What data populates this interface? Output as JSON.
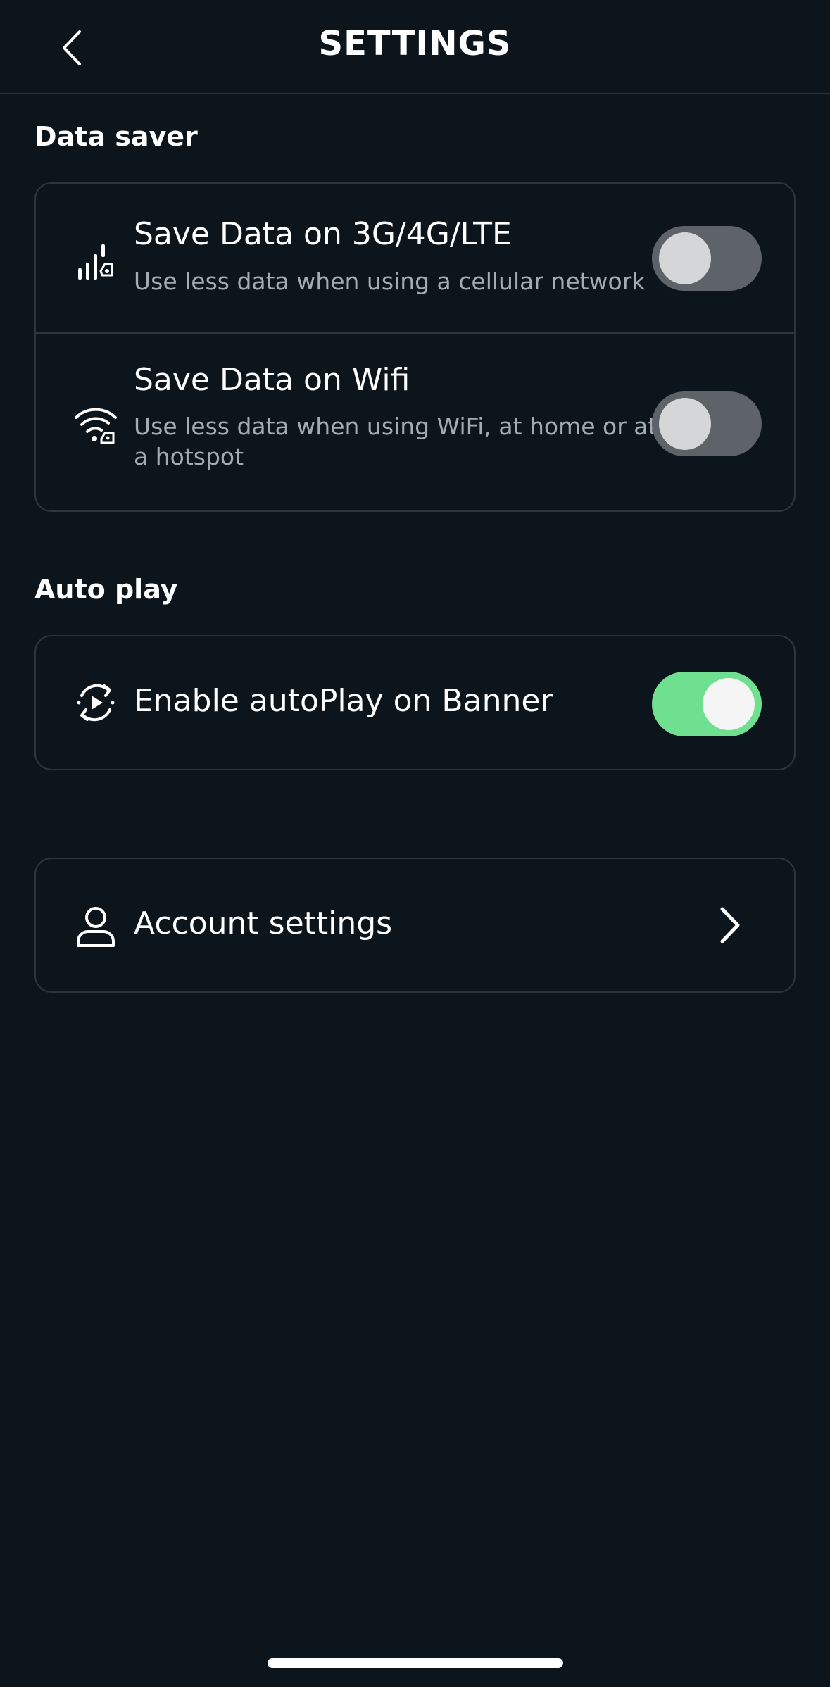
{
  "header": {
    "title": "SETTINGS",
    "back_icon": "chevron-left-icon"
  },
  "data_saver": {
    "section_title": "Data saver",
    "items": [
      {
        "icon": "cellular-data-saver-icon",
        "title": "Save Data on 3G/4G/LTE",
        "subtitle": "Use less data when using a cellular network",
        "enabled": false
      },
      {
        "icon": "wifi-data-saver-icon",
        "title": "Save Data on Wifi",
        "subtitle": "Use less data when using WiFi, at home or at a hotspot",
        "enabled": false
      }
    ]
  },
  "auto_play": {
    "section_title": "Auto play",
    "items": [
      {
        "icon": "autoplay-icon",
        "title": "Enable autoPlay on Banner",
        "enabled": true
      }
    ]
  },
  "account": {
    "icon": "user-icon",
    "label": "Account settings",
    "chevron_icon": "chevron-right-icon"
  },
  "colors": {
    "background": "#0d151c",
    "toggle_on": "#6fe090",
    "toggle_off": "#5d6368",
    "subtitle": "#a4abb2",
    "border": "#2c3640"
  }
}
